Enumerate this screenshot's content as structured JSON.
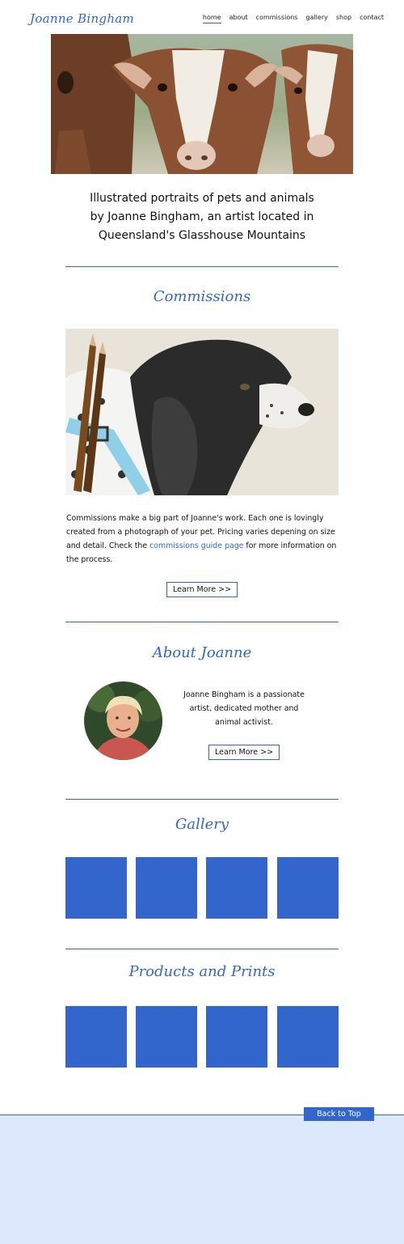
{
  "header": {
    "logo": "Joanne Bingham",
    "nav": [
      "home",
      "about",
      "commissions",
      "gallery",
      "shop",
      "contact"
    ]
  },
  "intro": {
    "line1": "Illustrated portraits of pets and animals",
    "line2": "by Joanne Bingham, an artist located in",
    "line3": "Queensland's Glasshouse Mountains"
  },
  "commissions": {
    "title": "Commissions",
    "text_before": "Commissions make a big part of Joanne's work. Each one is lovingly created from a photograph of your pet. Pricing varies depening on size and detail. Check the ",
    "link": "commissions guide page",
    "text_after": " for more information on the process.",
    "button": "Learn More   >>"
  },
  "about": {
    "title": "About Joanne",
    "text": "Joanne Bingham is a passionate artist, dedicated mother and animal activist.",
    "button": "Learn More   >>"
  },
  "gallery": {
    "title": "Gallery"
  },
  "products": {
    "title": "Products and Prints"
  },
  "footer": {
    "back_to_top": "Back to Top"
  },
  "colors": {
    "accent": "#3366cc",
    "footer_bg": "#dce8fb"
  }
}
